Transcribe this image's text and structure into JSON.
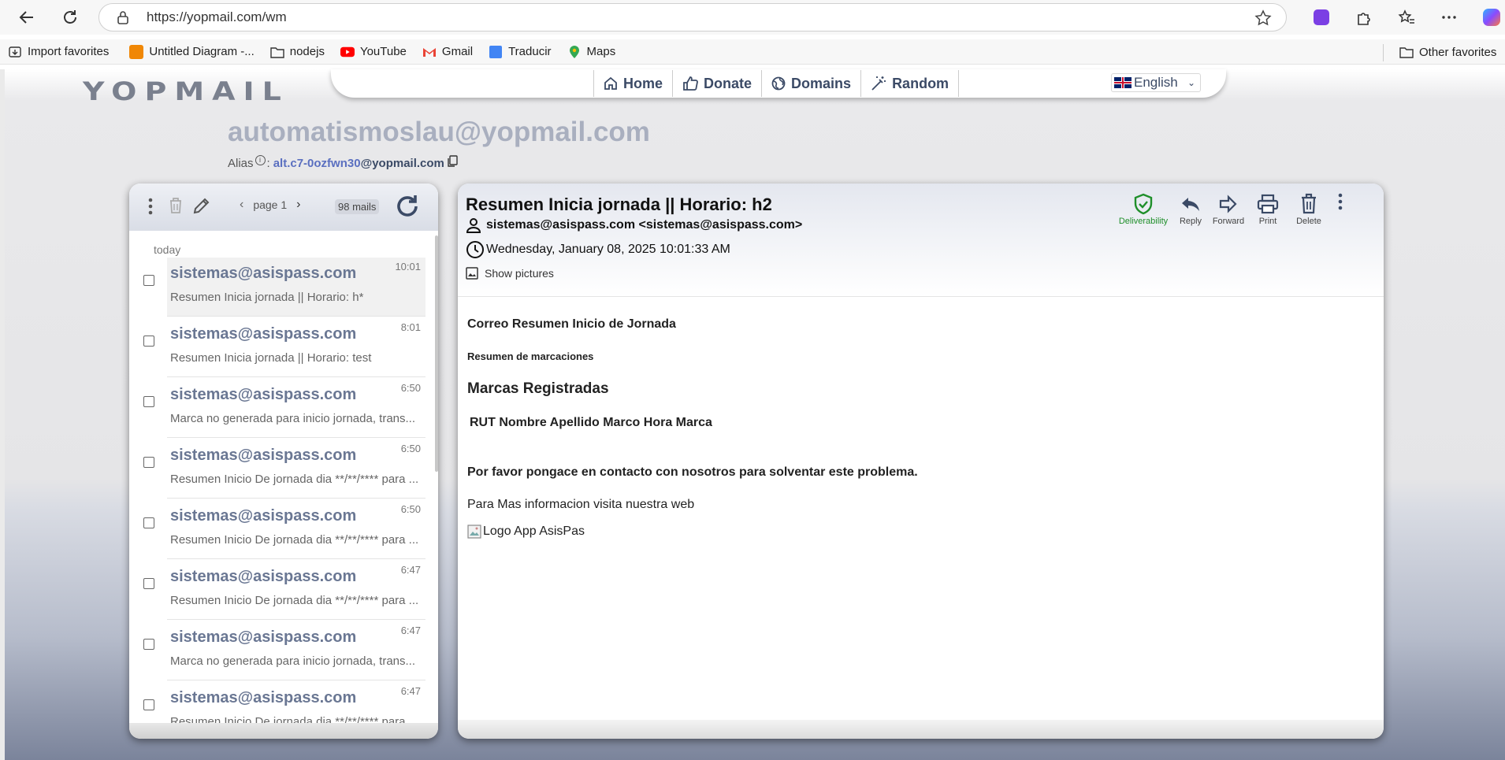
{
  "browser": {
    "url": "https://yopmail.com/wm",
    "bookmarks": [
      {
        "label": "Import favorites",
        "icon": "import-icon"
      },
      {
        "label": "Untitled Diagram -...",
        "icon": "drawio-icon"
      },
      {
        "label": "nodejs",
        "icon": "folder-icon"
      },
      {
        "label": "YouTube",
        "icon": "youtube-icon"
      },
      {
        "label": "Gmail",
        "icon": "gmail-icon"
      },
      {
        "label": "Traducir",
        "icon": "translate-icon"
      },
      {
        "label": "Maps",
        "icon": "maps-icon"
      }
    ],
    "other_favorites": "Other favorites"
  },
  "site": {
    "logo": "YOPMAIL",
    "nav": [
      {
        "label": "Home",
        "icon": "home-icon"
      },
      {
        "label": "Donate",
        "icon": "thumbs-up-icon"
      },
      {
        "label": "Domains",
        "icon": "globe-icon"
      },
      {
        "label": "Random",
        "icon": "magic-wand-icon"
      }
    ],
    "language": "English"
  },
  "inbox": {
    "email": "automatismoslau@yopmail.com",
    "alias_label": "Alias",
    "alias_sep": ":",
    "alias_value": "alt.c7-0ozfwn30",
    "alias_domain": "@yopmail.com"
  },
  "mail_list": {
    "page_label": "page 1",
    "count_label": "98 mails",
    "day_label": "today",
    "items": [
      {
        "from": "sistemas@asispass.com",
        "subject": "Resumen Inicia jornada || Horario: h*",
        "time": "10:01"
      },
      {
        "from": "sistemas@asispass.com",
        "subject": "Resumen Inicia jornada || Horario: test",
        "time": "8:01"
      },
      {
        "from": "sistemas@asispass.com",
        "subject": "Marca no generada para inicio jornada, trans...",
        "time": "6:50"
      },
      {
        "from": "sistemas@asispass.com",
        "subject": "Resumen Inicio De jornada dia **/**/**** para ...",
        "time": "6:50"
      },
      {
        "from": "sistemas@asispass.com",
        "subject": "Resumen Inicio De jornada dia **/**/**** para ...",
        "time": "6:50"
      },
      {
        "from": "sistemas@asispass.com",
        "subject": "Resumen Inicio De jornada dia **/**/**** para ...",
        "time": "6:47"
      },
      {
        "from": "sistemas@asispass.com",
        "subject": "Marca no generada para inicio jornada, trans...",
        "time": "6:47"
      },
      {
        "from": "sistemas@asispass.com",
        "subject": "Resumen Inicio De jornada dia **/**/**** para ...",
        "time": "6:47"
      }
    ]
  },
  "message": {
    "subject": "Resumen Inicia jornada || Horario: h2",
    "from": "sistemas@asispass.com <sistemas@asispass.com>",
    "date": "Wednesday, January 08, 2025 10:01:33 AM",
    "show_pictures": "Show pictures",
    "actions": {
      "deliverability": "Deliverability",
      "reply": "Reply",
      "forward": "Forward",
      "print": "Print",
      "delete": "Delete"
    },
    "body": {
      "heading": "Correo Resumen Inicio de Jornada",
      "subheading": "Resumen de marcaciones",
      "section_title": "Marcas Registradas",
      "table_header": "RUT Nombre Apellido Marco Hora Marca",
      "problem_text": "Por favor pongace en contacto con nosotros para solventar este problema.",
      "info_text": "Para Mas informacion visita nuestra web",
      "image_alt": "Logo App AsisPas"
    }
  },
  "colors": {
    "accent_text": "#3b4a66",
    "sender": "#6a7793",
    "deliverability_green": "#1f8f2a",
    "alias_link": "#5a6fc0"
  }
}
